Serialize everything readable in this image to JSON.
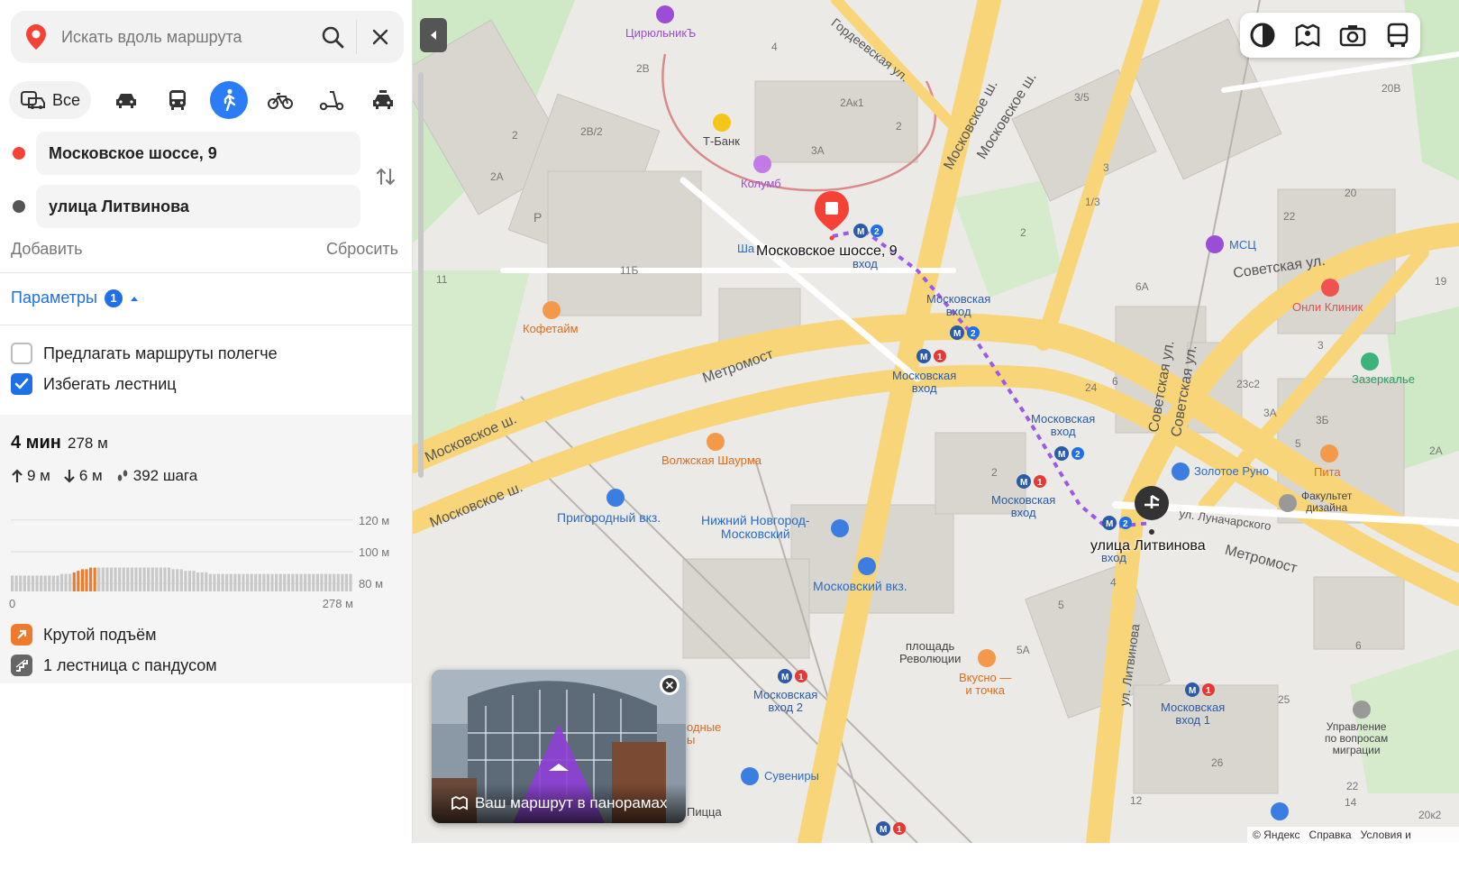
{
  "search": {
    "placeholder": "Искать вдоль маршрута"
  },
  "modes": {
    "all_label": "Все",
    "active": "pedestrian"
  },
  "route": {
    "from": "Московское шоссе, 9",
    "to": "улица Литвинова",
    "add_label": "Добавить",
    "reset_label": "Сбросить"
  },
  "params": {
    "label": "Параметры",
    "count": "1"
  },
  "options": [
    {
      "label": "Предлагать маршруты полегче",
      "checked": false
    },
    {
      "label": "Избегать лестниц",
      "checked": true
    }
  ],
  "result": {
    "time": "4 мин",
    "distance": "278 м",
    "ascent": "9 м",
    "descent": "6 м",
    "steps": "392 шага"
  },
  "chart_data": {
    "type": "bar",
    "title": "",
    "xlabel": "",
    "ylabel": "",
    "x_ticks": [
      "0",
      "278 м"
    ],
    "y_ticks": [
      "120 м",
      "100 м",
      "80 м"
    ],
    "ylim": [
      75,
      125
    ],
    "steep_color": "#f07a2b",
    "normal_color": "#c8c8c8",
    "values": [
      85,
      85,
      85,
      85,
      85,
      85,
      85,
      85,
      85,
      85,
      85,
      85,
      86,
      86,
      86,
      87,
      88,
      89,
      89,
      90,
      90,
      90,
      90,
      90,
      90,
      90,
      90,
      90,
      90,
      90,
      90,
      90,
      90,
      90,
      90,
      90,
      90,
      90,
      90,
      89,
      89,
      89,
      88,
      88,
      88,
      87,
      87,
      87,
      86,
      86,
      86,
      86,
      86,
      86,
      86,
      86,
      86,
      86,
      86,
      86,
      86,
      86,
      86,
      86,
      86,
      86,
      86,
      86,
      86,
      86,
      86,
      86,
      86,
      86,
      86,
      86,
      86,
      86,
      86,
      86,
      86,
      86,
      86
    ],
    "steep": [
      15,
      16,
      17,
      18,
      19,
      20
    ]
  },
  "features": [
    {
      "label": "Крутой подъём",
      "icon": "steep-ascent-icon",
      "color": "#f07a2b"
    },
    {
      "label": "1 лестница с пандусом",
      "icon": "stairs-ramp-icon",
      "color": "#666666"
    }
  ],
  "map": {
    "route_from_label": "Московское шоссе, 9",
    "route_to_label": "улица Литвинова",
    "streets": {
      "metromost1": "Метромост",
      "metromost2": "Метромост",
      "moskovskoe1": "Московское ш.",
      "moskovskoe2": "Московское ш.",
      "moskovskoe3": "Московское ш.",
      "moskovskoe4": "Московское ш.",
      "sovetskaya1": "Советская ул.",
      "sovetskaya2": "Советская ул.",
      "sovetskaya3": "Советская ул.",
      "gordeevskaya": "Гордеевская ул.",
      "lunacharskogo": "ул. Луначарского",
      "litvinova": "ул. Литвинова",
      "revolution_square": "площадь\nРеволюции"
    },
    "pois": {
      "cirulnik": "ЦирюльникЪ",
      "tbank": "Т-Банк",
      "kolumb": "Колумб",
      "kofetime": "Кофетайм",
      "volzhskaya": "Волжская Шаурма",
      "prigorodny": "Пригородный вкз.",
      "nn_moskovsky": "Нижний Новгород-\nМосковский",
      "moskovsky_vkz": "Московский вкз.",
      "msc": "МСЦ",
      "onli_klinik": "Онли Клиник",
      "zazerkalye": "Зазеркалье",
      "zolotoe_runo": "Золотое Руно",
      "pita": "Пита",
      "fakultet": "Факультет\nдизайна",
      "vkusno": "Вкусно —\nи точка",
      "suveniry": "Сувениры",
      "pizza": "Пицца",
      "upravlenie": "Управление\nпо вопросам\nмиграции",
      "sha": "Ша",
      "odnye": "одные\nы"
    },
    "metro": {
      "m1": "Московская\nвход",
      "m2": "Московская\nвход",
      "m3": "Московская\nвход",
      "m4": "Московская\nвход",
      "m5": "Московская\nвход 2",
      "m6": "Московская\nвход 1",
      "m7": "вход",
      "m8": "вход"
    },
    "houses": [
      "4",
      "2В",
      "2Ак1",
      "2",
      "3/5",
      "20В",
      "2В/2",
      "2",
      "3А",
      "2А",
      "3",
      "1/3",
      "20",
      "22",
      "2",
      "11",
      "11Б",
      "6А",
      "19",
      "3",
      "23с2",
      "3А",
      "3Б",
      "5",
      "2А",
      "24",
      "6",
      "2",
      "5",
      "5А",
      "4",
      "6",
      "25",
      "26",
      "22",
      "12",
      "14",
      "20к2",
      "Р"
    ]
  },
  "pano": {
    "caption": "Ваш маршрут в панорамах"
  },
  "copyright": {
    "yandex": "© Яндекс",
    "help": "Справка",
    "terms": "Условия и"
  },
  "colors": {
    "accent": "#2b7cf7",
    "route_start": "#f44336",
    "route_end": "#555555",
    "walk_route": "#9b59e8",
    "road": "#fbd67a"
  }
}
